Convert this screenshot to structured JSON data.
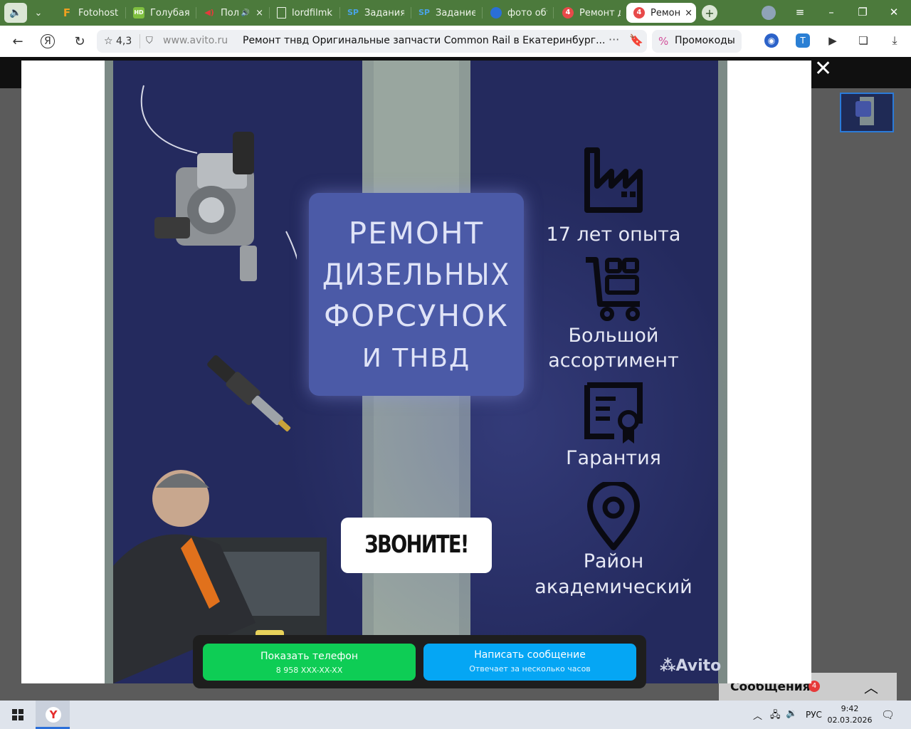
{
  "browser": {
    "tabs": [
      {
        "label": "",
        "icon": "speaker-icon"
      },
      {
        "label": "Fotohost",
        "icon": "F"
      },
      {
        "label": "Голубая",
        "icon": "HD"
      },
      {
        "label": "Пол",
        "icon": "audio-icon"
      },
      {
        "label": "lordfilmk",
        "icon": "page-icon"
      },
      {
        "label": "Задания",
        "icon": "SP"
      },
      {
        "label": "Задание",
        "icon": "SP"
      },
      {
        "label": "фото объ",
        "icon": "photo-icon"
      },
      {
        "label": "Ремонт д",
        "icon": "4"
      },
      {
        "label": "Ремон",
        "icon": "4",
        "active": true
      }
    ],
    "rating": "4,3",
    "domain": "www.avito.ru",
    "page_title": "Ремонт тнвд Оригинальные запчасти Common Rail в Екатеринбург...",
    "promo_label": "Промокоды"
  },
  "poster": {
    "title_lines": [
      "РЕМОНТ",
      "ДИЗЕЛЬНЫХ",
      "ФОРСУНОК",
      "И ТНВД"
    ],
    "call_label": "ЗВОНИТЕ!",
    "features": [
      {
        "icon": "factory-icon",
        "lines": [
          "17 лет опыта"
        ]
      },
      {
        "icon": "cart-icon",
        "lines": [
          "Большой",
          "ассортимент"
        ]
      },
      {
        "icon": "certificate-icon",
        "lines": [
          "Гарантия"
        ]
      },
      {
        "icon": "location-pin-icon",
        "lines": [
          "Район",
          "академический"
        ]
      }
    ],
    "watermark": "Avito"
  },
  "actions": {
    "phone_label": "Показать телефон",
    "phone_sub": "8 958 XXX-XX-XX",
    "message_label": "Написать сообщение",
    "message_sub": "Отвечает за несколько часов"
  },
  "messages": {
    "label": "Сообщения",
    "badge": "4"
  },
  "taskbar": {
    "lang": "РУС",
    "time": "9:42",
    "date": "02.03.2026"
  },
  "colors": {
    "tab_bar": "#4c7a3c",
    "poster_bg": "#242a5e",
    "phone_button": "#0ecd55",
    "message_button": "#05a6f4"
  }
}
